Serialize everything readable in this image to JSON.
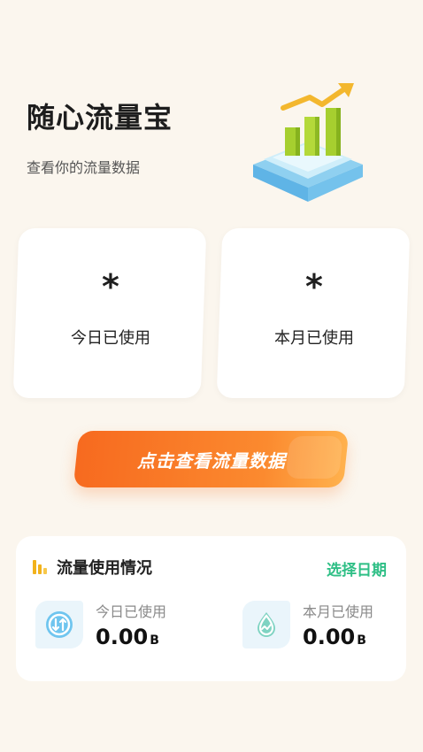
{
  "header": {
    "title": "随心流量宝",
    "subtitle": "查看你的流量数据"
  },
  "hero": {
    "icon": "growth-chart-illustration"
  },
  "cards": {
    "today": {
      "value": "*",
      "label": "今日已使用"
    },
    "month": {
      "value": "*",
      "label": "本月已使用"
    }
  },
  "cta": {
    "label": "点击查看流量数据",
    "color_from": "#f76a1f",
    "color_to": "#ffb14d"
  },
  "usage": {
    "title": "流量使用情况",
    "date_picker": "选择日期",
    "accent": "#2fbf86",
    "today": {
      "label": "今日已使用",
      "value": "0.00",
      "unit": "B",
      "icon": "transfer-arrows-icon"
    },
    "month": {
      "label": "本月已使用",
      "value": "0.00",
      "unit": "B",
      "icon": "water-drop-icon"
    }
  }
}
